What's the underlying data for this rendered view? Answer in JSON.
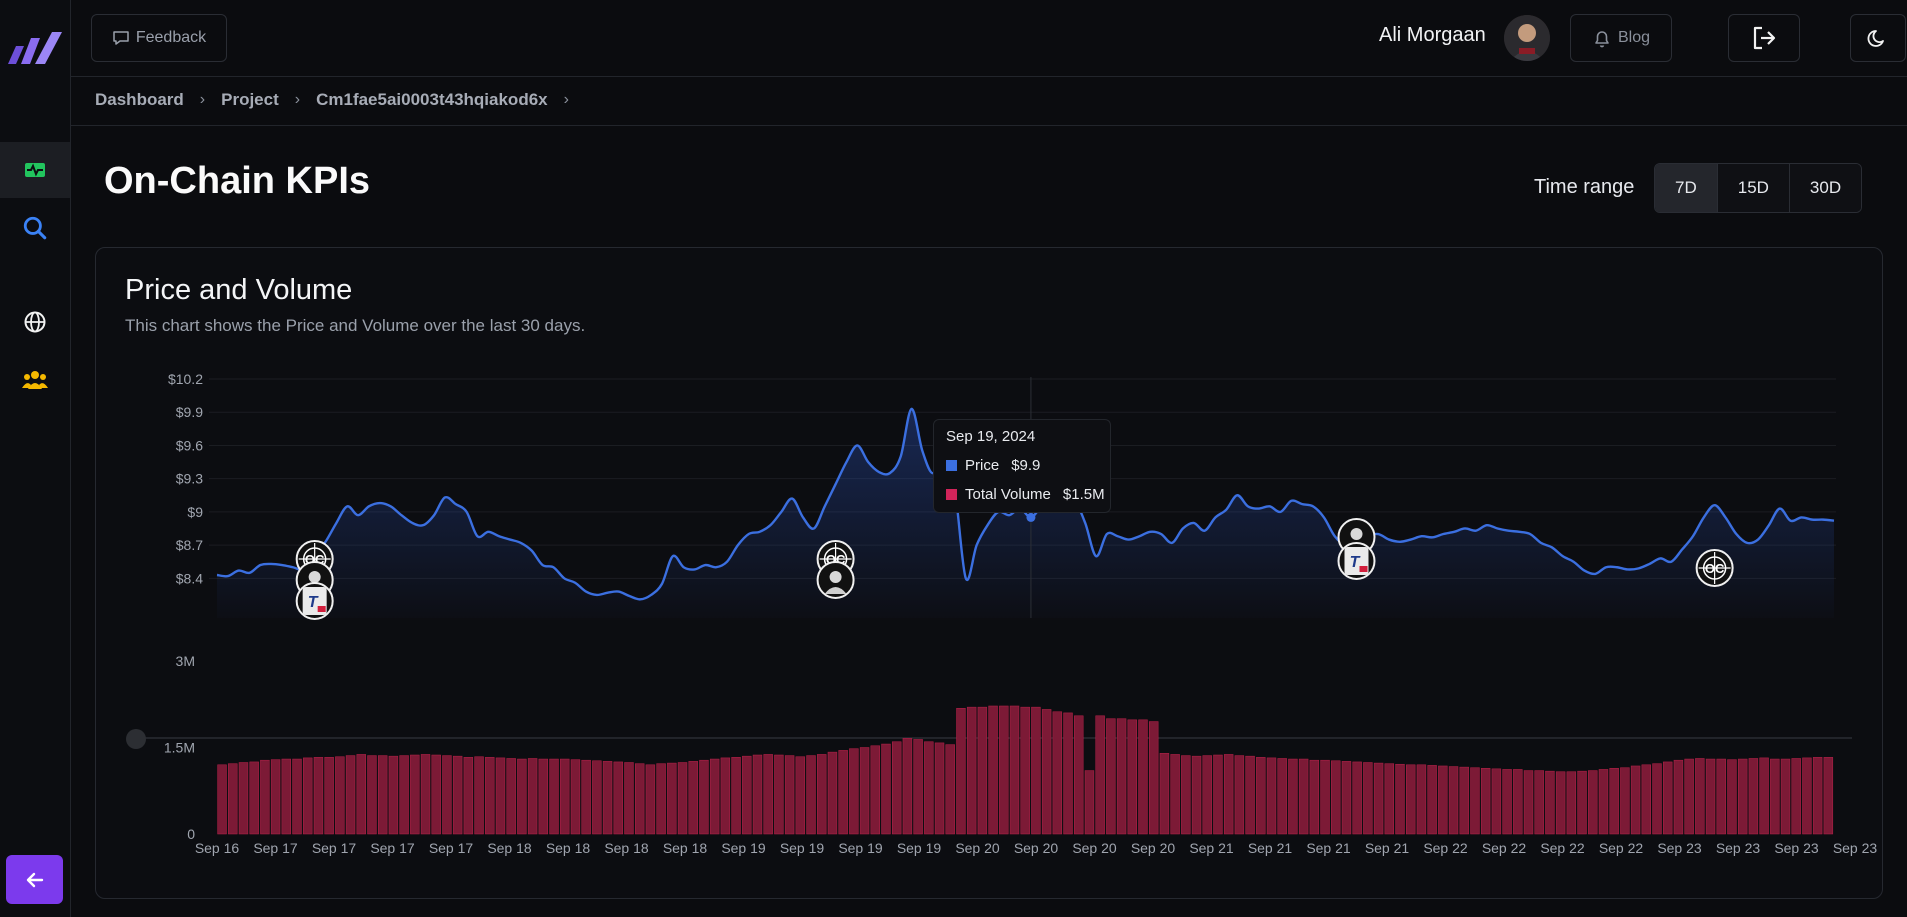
{
  "sidebar": {
    "logo": "bars-logo",
    "items": [
      "activity-icon",
      "search-icon",
      "globe-icon",
      "users-icon"
    ],
    "back_icon": "arrow-left-icon"
  },
  "topbar": {
    "feedback_label": "Feedback",
    "username": "Ali Morgaan",
    "blog_label": "Blog"
  },
  "breadcrumb": [
    "Dashboard",
    "Project",
    "Cm1fae5ai0003t43hqiakod6x"
  ],
  "page": {
    "title": "On-Chain KPIs",
    "time_range_label": "Time range",
    "ranges": [
      "7D",
      "15D",
      "30D"
    ],
    "active_range": "7D"
  },
  "card": {
    "title": "Price and Volume",
    "description": "This chart shows the Price and Volume over the last 30 days."
  },
  "tooltip": {
    "date": "Sep 19, 2024",
    "rows": [
      {
        "label": "Price",
        "value": "$9.9"
      },
      {
        "label": "Total Volume",
        "value": "$1.5M"
      }
    ]
  },
  "colors": {
    "price": "#3b6fe0",
    "volume": "#b8224a",
    "accent": "#7c3aed"
  },
  "chart_data": [
    {
      "type": "line",
      "series": [
        {
          "name": "Price"
        }
      ],
      "y_tick_labels": [
        "$10.2",
        "$9.9",
        "$9.6",
        "$9.3",
        "$9",
        "$8.7",
        "$8.4"
      ],
      "ylim": [
        8.15,
        10.2
      ],
      "values": [
        8.43,
        8.42,
        8.47,
        8.45,
        8.52,
        8.53,
        8.52,
        8.5,
        8.48,
        8.6,
        8.73,
        8.9,
        9.05,
        8.97,
        9.05,
        9.08,
        9.05,
        8.97,
        8.9,
        8.88,
        8.97,
        9.13,
        9.07,
        9.0,
        8.78,
        8.82,
        8.78,
        8.75,
        8.72,
        8.65,
        8.52,
        8.5,
        8.4,
        8.36,
        8.28,
        8.25,
        8.27,
        8.28,
        8.24,
        8.21,
        8.25,
        8.35,
        8.6,
        8.5,
        8.48,
        8.52,
        8.5,
        8.55,
        8.7,
        8.8,
        8.82,
        8.88,
        9.0,
        9.12,
        8.95,
        8.85,
        9.05,
        9.25,
        9.45,
        9.6,
        9.45,
        9.36,
        9.35,
        9.5,
        9.93,
        9.55,
        9.35,
        9.6,
        9.2,
        8.4,
        8.7,
        8.88,
        9.0,
        8.97,
        9.03,
        8.95,
        9.05,
        9.08,
        9.06,
        9.1,
        8.9,
        8.6,
        8.8,
        8.78,
        8.75,
        8.78,
        8.82,
        8.8,
        8.72,
        8.85,
        8.9,
        8.83,
        8.95,
        9.02,
        9.15,
        9.05,
        9.03,
        9.05,
        9.0,
        9.1,
        9.07,
        9.05,
        8.95,
        8.78,
        8.7,
        8.72,
        8.78,
        8.8,
        8.75,
        8.73,
        8.75,
        8.78,
        8.77,
        8.8,
        8.82,
        8.85,
        8.83,
        8.88,
        8.85,
        8.83,
        8.82,
        8.8,
        8.72,
        8.68,
        8.6,
        8.55,
        8.47,
        8.44,
        8.5,
        8.5,
        8.48,
        8.49,
        8.53,
        8.58,
        8.55,
        8.66,
        8.78,
        8.95,
        9.06,
        8.95,
        8.8,
        8.72,
        8.75,
        8.88,
        9.03,
        8.92,
        8.95,
        8.93,
        8.93,
        8.92
      ]
    },
    {
      "type": "bar",
      "series": [
        {
          "name": "Total Volume"
        }
      ],
      "y_tick_labels": [
        "3M",
        "1.5M",
        "0"
      ],
      "ylim": [
        0,
        3000000
      ],
      "x_tick_labels": [
        "Sep 16",
        "Sep 17",
        "Sep 17",
        "Sep 17",
        "Sep 17",
        "Sep 18",
        "Sep 18",
        "Sep 18",
        "Sep 18",
        "Sep 19",
        "Sep 19",
        "Sep 19",
        "Sep 19",
        "Sep 20",
        "Sep 20",
        "Sep 20",
        "Sep 20",
        "Sep 21",
        "Sep 21",
        "Sep 21",
        "Sep 21",
        "Sep 22",
        "Sep 22",
        "Sep 22",
        "Sep 22",
        "Sep 23",
        "Sep 23",
        "Sep 23",
        "Sep 23"
      ],
      "values": [
        1.2,
        1.22,
        1.24,
        1.25,
        1.28,
        1.29,
        1.3,
        1.3,
        1.32,
        1.33,
        1.33,
        1.34,
        1.36,
        1.38,
        1.36,
        1.36,
        1.35,
        1.36,
        1.37,
        1.38,
        1.37,
        1.36,
        1.35,
        1.33,
        1.34,
        1.33,
        1.32,
        1.31,
        1.3,
        1.31,
        1.3,
        1.3,
        1.3,
        1.29,
        1.28,
        1.27,
        1.26,
        1.25,
        1.24,
        1.22,
        1.2,
        1.22,
        1.23,
        1.24,
        1.26,
        1.28,
        1.3,
        1.32,
        1.33,
        1.35,
        1.37,
        1.38,
        1.37,
        1.36,
        1.34,
        1.36,
        1.38,
        1.42,
        1.45,
        1.48,
        1.5,
        1.53,
        1.56,
        1.6,
        1.66,
        1.64,
        1.6,
        1.58,
        1.55,
        2.18,
        2.2,
        2.2,
        2.22,
        2.22,
        2.22,
        2.2,
        2.2,
        2.16,
        2.12,
        2.1,
        2.05,
        1.1,
        2.05,
        2.0,
        2.0,
        1.98,
        1.98,
        1.95,
        1.4,
        1.38,
        1.36,
        1.35,
        1.36,
        1.37,
        1.38,
        1.36,
        1.35,
        1.33,
        1.32,
        1.31,
        1.3,
        1.3,
        1.28,
        1.28,
        1.27,
        1.26,
        1.25,
        1.24,
        1.23,
        1.22,
        1.21,
        1.2,
        1.2,
        1.19,
        1.18,
        1.17,
        1.16,
        1.15,
        1.14,
        1.13,
        1.12,
        1.12,
        1.1,
        1.1,
        1.09,
        1.08,
        1.08,
        1.09,
        1.1,
        1.12,
        1.14,
        1.15,
        1.18,
        1.2,
        1.22,
        1.25,
        1.28,
        1.3,
        1.31,
        1.3,
        1.3,
        1.29,
        1.3,
        1.31,
        1.32,
        1.3,
        1.3,
        1.31,
        1.32,
        1.33,
        1.33
      ]
    }
  ],
  "events": [
    {
      "i": 9,
      "icons": [
        "oc-icon",
        "person-icon",
        "t-logo-icon"
      ]
    },
    {
      "i": 57,
      "icons": [
        "oc-icon",
        "person-icon"
      ]
    },
    {
      "i": 105,
      "icons": [
        "person-icon",
        "t-logo-icon"
      ]
    },
    {
      "i": 138,
      "icons": [
        "oc-icon"
      ]
    }
  ],
  "hover_index": 75
}
